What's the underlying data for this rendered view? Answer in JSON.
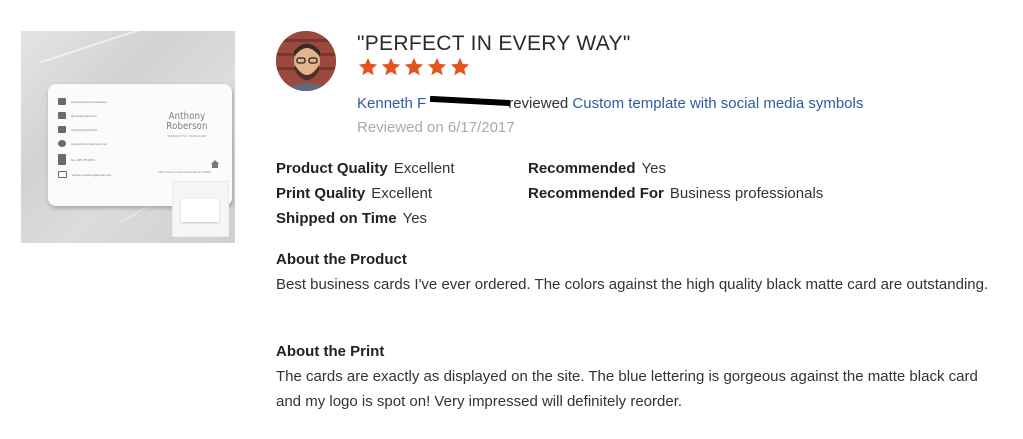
{
  "review": {
    "title": "\"PERFECT IN EVERY WAY\"",
    "rating": 5,
    "rating_max": 5,
    "reviewer_name": "Kenneth F",
    "reviewed_verb": "reviewed",
    "product_link": "Custom template with social media symbols",
    "reviewed_date": "Reviewed on 6/17/2017",
    "star_color": "#e5541e",
    "link_color": "#2c5e9e"
  },
  "attributes": [
    {
      "label": "Product Quality",
      "value": "Excellent"
    },
    {
      "label": "Print Quality",
      "value": "Excellent"
    },
    {
      "label": "Shipped on Time",
      "value": "Yes"
    },
    {
      "label": "Recommended",
      "value": "Yes"
    },
    {
      "label": "Recommended For",
      "value": "Business professionals"
    }
  ],
  "sections": [
    {
      "heading": "About the Product",
      "body": "Best business cards I've ever ordered. The colors against the high quality black matte card are outstanding."
    },
    {
      "heading": "About the Print",
      "body": "The cards are exactly as displayed on the site. The blue lettering is gorgeous against the matte black card and my logo is spot on! Very impressed will definitely reorder."
    }
  ],
  "card": {
    "name_line1": "Anthony",
    "name_line2": "Roberson",
    "role": "MARKETING MANAGER",
    "rows": [
      "anthonyrobersonmarketing",
      "@anthonyroberson",
      "anthonyroberson23",
      "www.anthonyroberson.com",
      "Tel. 285 473 0974",
      "anthonyroberson@email.com"
    ],
    "address": "1227 Avenue of the Americas NY 10029",
    "icons": [
      "facebook-icon",
      "twitter-icon",
      "instagram-icon",
      "globe-icon",
      "phone-icon",
      "mail-icon"
    ]
  }
}
